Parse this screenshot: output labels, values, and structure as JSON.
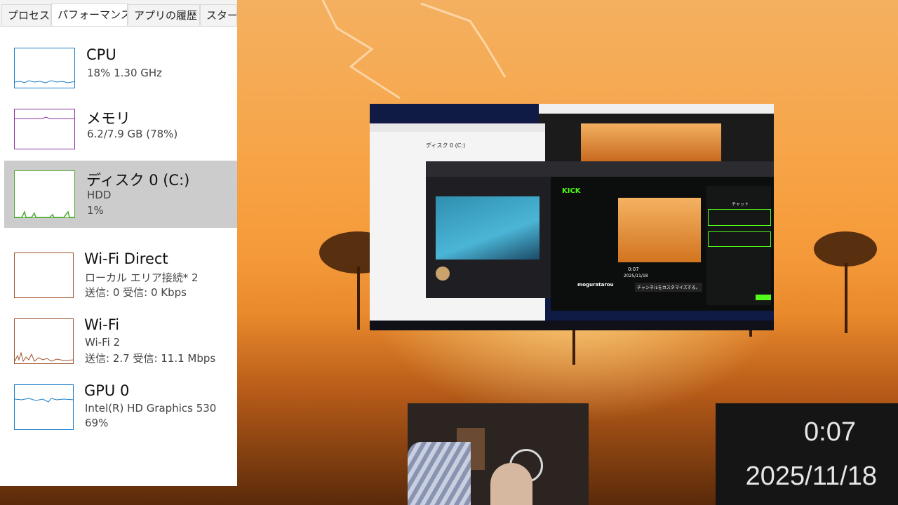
{
  "task_manager": {
    "tabs": [
      "プロセス",
      "パフォーマンス",
      "アプリの履歴",
      "スタート"
    ],
    "active_tab": "パフォーマンス",
    "items": [
      {
        "title": "CPU",
        "sub1": "18%  1.30 GHz",
        "sub2": "",
        "color": "#1a7ec8"
      },
      {
        "title": "メモリ",
        "sub1": "6.2/7.9 GB (78%)",
        "sub2": "",
        "color": "#8b2f9e"
      },
      {
        "title": "ディスク 0 (C:)",
        "sub1": "HDD",
        "sub2": "1%",
        "color": "#4ca832",
        "selected": true
      },
      {
        "title": "Wi-Fi Direct",
        "sub1": "ローカル エリア接続* 2",
        "sub2": "送信: 0 受信: 0 Kbps",
        "color": "#a0522d"
      },
      {
        "title": "Wi-Fi",
        "sub1": "Wi-Fi 2",
        "sub2": "送信: 2.7 受信: 11.1 Mbps",
        "color": "#a0522d"
      },
      {
        "title": "GPU 0",
        "sub1": "Intel(R) HD Graphics 530",
        "sub2": "69%",
        "color": "#1a7ec8"
      }
    ]
  },
  "thumbnail": {
    "explorer_title": "ディスク 0 (C:)",
    "stream_user": "moguratarou",
    "stream_time": "0:07",
    "stream_date": "2025/11/18",
    "chat_label": "チャット",
    "customize_label": "チャンネルをカスタマイズする。",
    "kick_logo": "KICK"
  },
  "overlay": {
    "time": "0:07",
    "date": "2025/11/18"
  },
  "colors": {
    "selected_bg": "#cccccc",
    "kick_green": "#53fc18"
  }
}
